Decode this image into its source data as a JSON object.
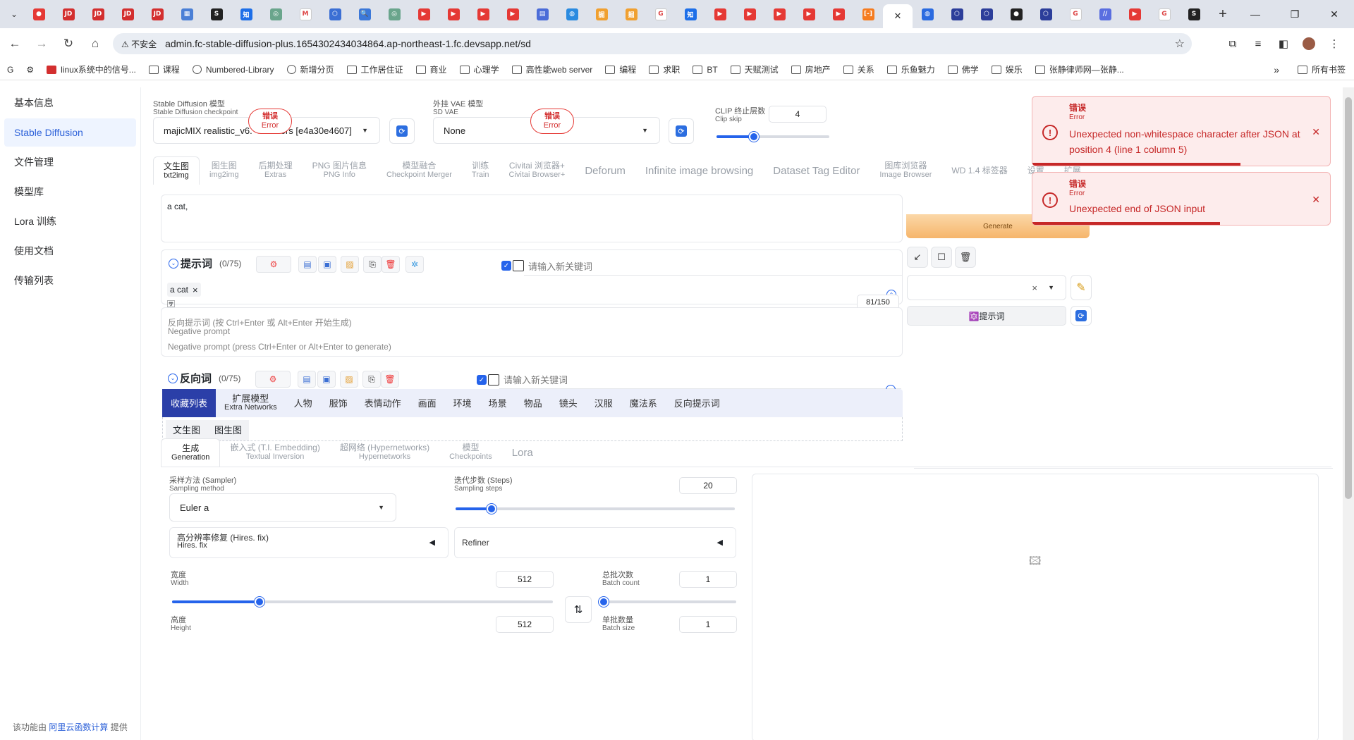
{
  "browser": {
    "tab_favicons": [
      {
        "icon": "youtube-icon",
        "bg": "#e53935",
        "glyph": "●"
      },
      {
        "icon": "jd-icon",
        "bg": "#d32f2f",
        "glyph": "JD"
      },
      {
        "icon": "jd-icon",
        "bg": "#d32f2f",
        "glyph": "JD"
      },
      {
        "icon": "jd-icon",
        "bg": "#d32f2f",
        "glyph": "JD"
      },
      {
        "icon": "jd-icon",
        "bg": "#d32f2f",
        "glyph": "JD"
      },
      {
        "icon": "calendar-icon",
        "bg": "#4a7fd6",
        "glyph": "▦"
      },
      {
        "icon": "s-icon",
        "bg": "#222",
        "glyph": "S"
      },
      {
        "icon": "zhihu-icon",
        "bg": "#1e6fe8",
        "glyph": "知"
      },
      {
        "icon": "chatgpt-icon",
        "bg": "#6aa58c",
        "glyph": "◎"
      },
      {
        "icon": "gmail-icon",
        "bg": "#ffffff",
        "glyph": "M"
      },
      {
        "icon": "hex-icon",
        "bg": "#3b6fd4",
        "glyph": "⬡"
      },
      {
        "icon": "search-icon",
        "bg": "#3c78d8",
        "glyph": "🔍"
      },
      {
        "icon": "chatgpt-icon",
        "bg": "#6aa58c",
        "glyph": "◎"
      },
      {
        "icon": "youtube-icon",
        "bg": "#e53935",
        "glyph": "▶"
      },
      {
        "icon": "youtube-icon",
        "bg": "#e53935",
        "glyph": "▶"
      },
      {
        "icon": "youtube-icon",
        "bg": "#e53935",
        "glyph": "▶"
      },
      {
        "icon": "youtube-icon",
        "bg": "#e53935",
        "glyph": "▶"
      },
      {
        "icon": "chat-icon",
        "bg": "#4b6cd8",
        "glyph": "▤"
      },
      {
        "icon": "globe-icon",
        "bg": "#2b8be0",
        "glyph": "◍"
      },
      {
        "icon": "juejin-icon",
        "bg": "#f0a030",
        "glyph": "掘"
      },
      {
        "icon": "juejin-icon",
        "bg": "#f0a030",
        "glyph": "掘"
      },
      {
        "icon": "google-icon",
        "bg": "#ffffff",
        "glyph": "G"
      },
      {
        "icon": "zhihu-icon",
        "bg": "#1e6fe8",
        "glyph": "知"
      },
      {
        "icon": "youtube-icon",
        "bg": "#e53935",
        "glyph": "▶"
      },
      {
        "icon": "youtube-icon",
        "bg": "#e53935",
        "glyph": "▶"
      },
      {
        "icon": "youtube-icon",
        "bg": "#e53935",
        "glyph": "▶"
      },
      {
        "icon": "youtube-icon",
        "bg": "#e53935",
        "glyph": "▶"
      },
      {
        "icon": "youtube-icon",
        "bg": "#e53935",
        "glyph": "▶"
      },
      {
        "icon": "aliyun-icon",
        "bg": "#f57c20",
        "glyph": "[-]"
      }
    ],
    "active_tab_close": "✕",
    "tab_favicons_right": [
      {
        "icon": "globe-icon",
        "bg": "#2b6be0",
        "glyph": "◍"
      },
      {
        "icon": "hex-icon",
        "bg": "#2c3e9a",
        "glyph": "⬡"
      },
      {
        "icon": "hex-icon",
        "bg": "#2c3e9a",
        "glyph": "⬡"
      },
      {
        "icon": "github-icon",
        "bg": "#222",
        "glyph": "●"
      },
      {
        "icon": "hex-icon",
        "bg": "#2c3e9a",
        "glyph": "⬡"
      },
      {
        "icon": "google-icon",
        "bg": "#ffffff",
        "glyph": "G"
      },
      {
        "icon": "stripes-icon",
        "bg": "#5a6ee0",
        "glyph": "//"
      },
      {
        "icon": "youtube-icon",
        "bg": "#e53935",
        "glyph": "▶"
      },
      {
        "icon": "google-icon",
        "bg": "#ffffff",
        "glyph": "G"
      },
      {
        "icon": "s-icon",
        "bg": "#222",
        "glyph": "S"
      }
    ],
    "new_tab": "+",
    "insecure_label": "⚠ 不安全",
    "url": "admin.fc-stable-diffusion-plus.1654302434034864.ap-northeast-1.fc.devsapp.net/sd",
    "bookmarks": [
      {
        "icon": "google-icon",
        "label": "G"
      },
      {
        "icon": "gear-icon",
        "label": "⚙"
      },
      {
        "icon": "folder-icon",
        "label": "linux系统中的信号..."
      },
      {
        "icon": "folder-icon",
        "label": "课程"
      },
      {
        "icon": "globe-icon",
        "label": "Numbered-Library"
      },
      {
        "icon": "globe-icon",
        "label": "新增分页"
      },
      {
        "icon": "folder-icon",
        "label": "工作居住证"
      },
      {
        "icon": "folder-icon",
        "label": "商业"
      },
      {
        "icon": "folder-icon",
        "label": "心理学"
      },
      {
        "icon": "folder-icon",
        "label": "高性能web server"
      },
      {
        "icon": "folder-icon",
        "label": "编程"
      },
      {
        "icon": "folder-icon",
        "label": "求职"
      },
      {
        "icon": "folder-icon",
        "label": "BT"
      },
      {
        "icon": "folder-icon",
        "label": "天赋测试"
      },
      {
        "icon": "folder-icon",
        "label": "房地产"
      },
      {
        "icon": "folder-icon",
        "label": "关系"
      },
      {
        "icon": "folder-icon",
        "label": "乐鱼魅力"
      },
      {
        "icon": "folder-icon",
        "label": "佛学"
      },
      {
        "icon": "folder-icon",
        "label": "娱乐"
      },
      {
        "icon": "feather-icon",
        "label": "张静律师网—张静..."
      }
    ],
    "bookmarks_more": "»",
    "all_bookmarks": "所有书签"
  },
  "sidebar": {
    "items": [
      {
        "label": "基本信息",
        "active": false
      },
      {
        "label": "Stable Diffusion",
        "active": true
      },
      {
        "label": "文件管理",
        "active": false
      },
      {
        "label": "模型库",
        "active": false
      },
      {
        "label": "Lora 训练",
        "active": false
      },
      {
        "label": "使用文档",
        "active": false
      },
      {
        "label": "传输列表",
        "active": false
      }
    ],
    "footer_prefix": "该功能由",
    "footer_link": "阿里云函数计算",
    "footer_suffix": "提供"
  },
  "sd": {
    "checkpoint": {
      "label_zh": "Stable Diffusion 模型",
      "label_en": "Stable Diffusion checkpoint",
      "value": "majicMIX realistic_v6.safetensors [e4a30e4607]",
      "visible_prefix": "majicMIX realistic_v6.",
      "visible_suffix": "ors [e4a30e4607]"
    },
    "vae": {
      "label_zh": "外挂 VAE 模型",
      "label_en": "SD VAE",
      "value": "None"
    },
    "error_badge": {
      "zh": "错误",
      "en": "Error"
    },
    "clip": {
      "label_zh": "CLIP 终止层数",
      "label_en": "Clip skip",
      "value": "4",
      "fraction": 0.33
    },
    "tabs": [
      {
        "zh": "文生图",
        "en": "txt2img",
        "active": true
      },
      {
        "zh": "图生图",
        "en": "img2img"
      },
      {
        "zh": "后期处理",
        "en": "Extras"
      },
      {
        "zh": "PNG 图片信息",
        "en": "PNG Info"
      },
      {
        "zh": "模型融合",
        "en": "Checkpoint Merger"
      },
      {
        "zh": "训练",
        "en": "Train"
      },
      {
        "zh": "Civitai 浏览器+",
        "en": "Civitai Browser+"
      },
      {
        "zh": "Deforum",
        "en": "",
        "big": true
      },
      {
        "zh": "Infinite image browsing",
        "en": "",
        "big": true
      },
      {
        "zh": "Dataset Tag Editor",
        "en": "",
        "big": true
      },
      {
        "zh": "图库浏览器",
        "en": "Image Browser"
      },
      {
        "zh": "WD 1.4 标签器",
        "en": ""
      },
      {
        "zh": "设置",
        "en": ""
      },
      {
        "zh": "扩展",
        "en": ""
      }
    ],
    "prompt_text": "a cat,",
    "prompt_section": {
      "title": "提示词",
      "count": "(0/75)",
      "keyword_placeholder": "请输入新关键词",
      "tag": "a cat",
      "tag_close": "×",
      "translate_icon": "🈂"
    },
    "token_counter": "81/150",
    "negative": {
      "placeholder_zh": "反向提示词 (按 Ctrl+Enter 或 Alt+Enter 开始生成)",
      "placeholder_label_en": "Negative prompt",
      "placeholder_en": "Negative prompt (press Ctrl+Enter or Alt+Enter to generate)"
    },
    "negative_section": {
      "title": "反向词",
      "count": "(0/75)",
      "keyword_placeholder": "请输入新关键词"
    },
    "categories": [
      {
        "zh": "收藏列表",
        "active": true
      },
      {
        "zh": "扩展模型",
        "en": "Extra Networks"
      },
      {
        "zh": "人物"
      },
      {
        "zh": "服饰"
      },
      {
        "zh": "表情动作"
      },
      {
        "zh": "画面"
      },
      {
        "zh": "环境"
      },
      {
        "zh": "场景"
      },
      {
        "zh": "物品"
      },
      {
        "zh": "镜头"
      },
      {
        "zh": "汉服"
      },
      {
        "zh": "魔法系"
      },
      {
        "zh": "反向提示词"
      }
    ],
    "subtabs": [
      {
        "label": "文生图",
        "active": true
      },
      {
        "label": "图生图"
      }
    ],
    "gen_tabs": [
      {
        "zh": "生成",
        "en": "Generation",
        "active": true
      },
      {
        "zh": "嵌入式 (T.I. Embedding)",
        "en": "Textual Inversion"
      },
      {
        "zh": "超网络 (Hypernetworks)",
        "en": "Hypernetworks"
      },
      {
        "zh": "模型",
        "en": "Checkpoints"
      },
      {
        "zh": "Lora",
        "en": "",
        "big": true
      }
    ],
    "sampler": {
      "label_zh": "采样方法 (Sampler)",
      "label_en": "Sampling method",
      "value": "Euler a"
    },
    "steps": {
      "label_zh": "迭代步数 (Steps)",
      "label_en": "Sampling steps",
      "value": "20",
      "fraction": 0.13
    },
    "hires": {
      "label_zh": "高分辨率修复 (Hires. fix)",
      "label_en": "Hires. fix"
    },
    "refiner": {
      "label": "Refiner"
    },
    "width": {
      "label_zh": "宽度",
      "label_en": "Width",
      "value": "512",
      "fraction": 0.23
    },
    "height": {
      "label_zh": "高度",
      "label_en": "Height",
      "value": "512"
    },
    "batch_count": {
      "label_zh": "总批次数",
      "label_en": "Batch count",
      "value": "1",
      "fraction": 0.0
    },
    "batch_size": {
      "label_zh": "单批数量",
      "label_en": "Batch size",
      "value": "1"
    },
    "swap_icon": "⇅"
  },
  "right_panel": {
    "generate_label": "Generate",
    "action_icons": [
      "↙",
      "☐",
      "🗑"
    ],
    "style_clear": "×",
    "prompt_btn": "🔯提示词"
  },
  "toasts": [
    {
      "title": "错误",
      "sub": "Error",
      "message": "Unexpected non-whitespace character after JSON at position 4 (line 1 column 5)",
      "progress": 0.7
    },
    {
      "title": "错误",
      "sub": "Error",
      "message": "Unexpected end of JSON input",
      "progress": 0.63
    }
  ],
  "colors": {
    "accent": "#2563eb",
    "error": "#c62828",
    "generate": "#f7b96b"
  }
}
